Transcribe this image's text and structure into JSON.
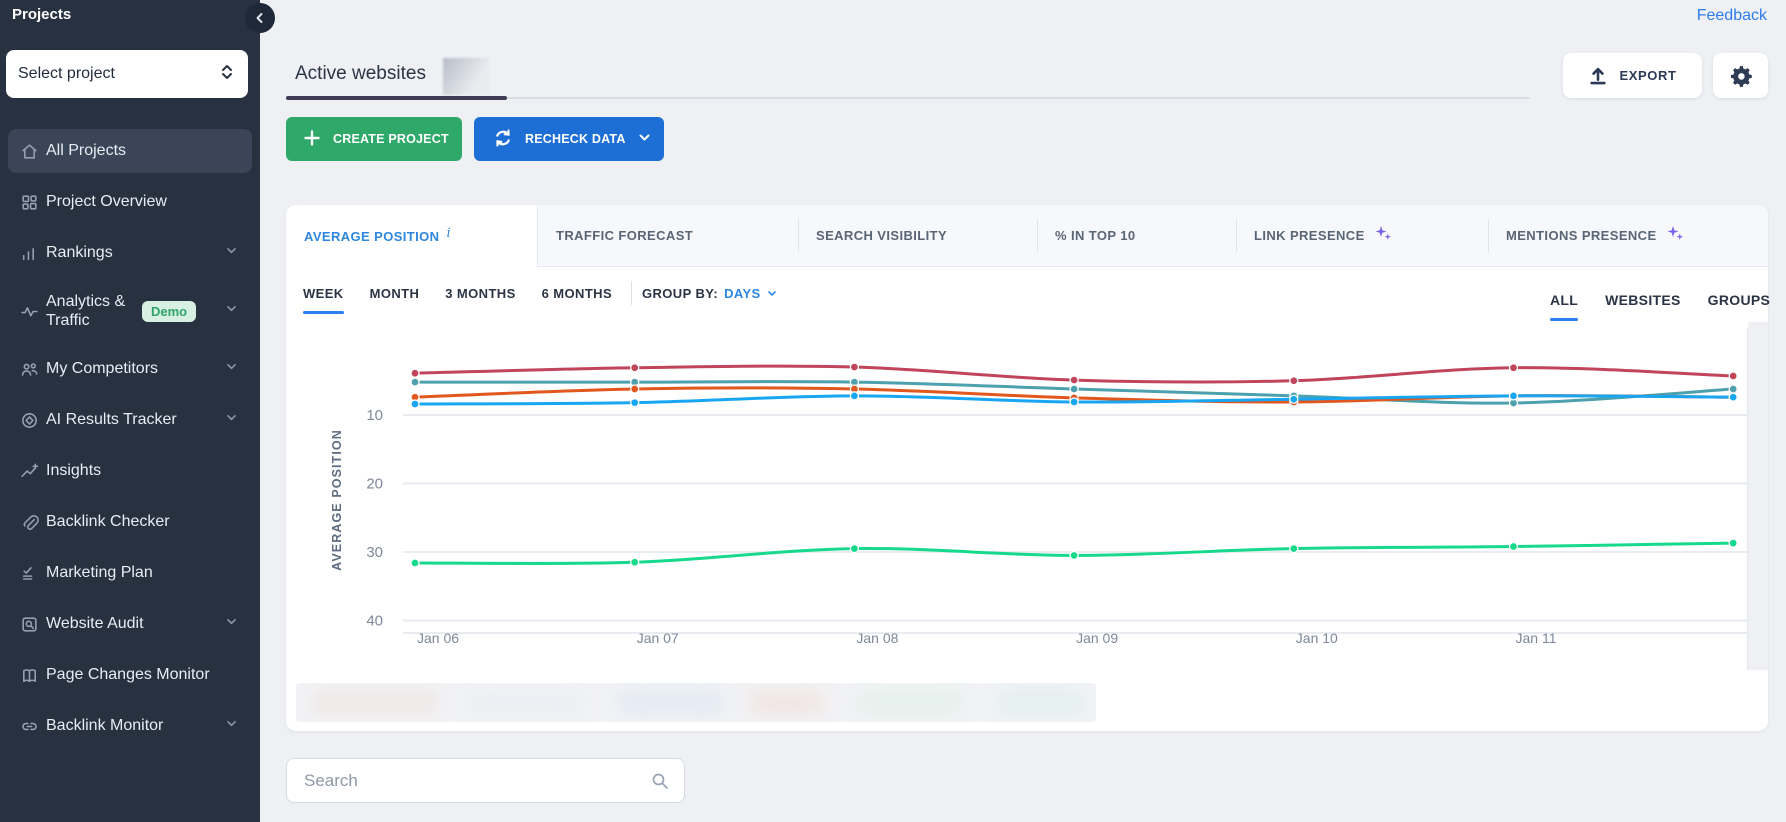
{
  "sidebar": {
    "title": "Projects",
    "select_placeholder": "Select project",
    "items": [
      {
        "label": "All Projects",
        "icon": "home",
        "active": true
      },
      {
        "label": "Project Overview",
        "icon": "grid"
      },
      {
        "label": "Rankings",
        "icon": "bar-chart",
        "expandable": true
      },
      {
        "label": "Analytics & Traffic",
        "icon": "activity",
        "expandable": true,
        "badge": "Demo",
        "two_line": true
      },
      {
        "label": "My Competitors",
        "icon": "people",
        "expandable": true
      },
      {
        "label": "AI Results Tracker",
        "icon": "ai-target",
        "expandable": true
      },
      {
        "label": "Insights",
        "icon": "insights"
      },
      {
        "label": "Backlink Checker",
        "icon": "paperclip"
      },
      {
        "label": "Marketing Plan",
        "icon": "checklist"
      },
      {
        "label": "Website Audit",
        "icon": "audit",
        "expandable": true
      },
      {
        "label": "Page Changes Monitor",
        "icon": "pages"
      },
      {
        "label": "Backlink Monitor",
        "icon": "link",
        "expandable": true
      }
    ]
  },
  "header": {
    "feedback": "Feedback",
    "tab": "Active websites",
    "create_project": "CREATE PROJECT",
    "recheck_data": "RECHECK DATA",
    "export": "EXPORT"
  },
  "metric_tabs": [
    {
      "label": "AVERAGE POSITION",
      "active": true,
      "info": true
    },
    {
      "label": "TRAFFIC FORECAST"
    },
    {
      "label": "SEARCH VISIBILITY"
    },
    {
      "label": "% IN TOP 10"
    },
    {
      "label": "LINK PRESENCE",
      "sparkle": true
    },
    {
      "label": "MENTIONS PRESENCE",
      "sparkle": true
    }
  ],
  "toolbar": {
    "ranges": [
      {
        "label": "WEEK",
        "active": true
      },
      {
        "label": "MONTH"
      },
      {
        "label": "3 MONTHS"
      },
      {
        "label": "6 MONTHS"
      }
    ],
    "group_by_label": "GROUP BY:",
    "group_by_value": "DAYS",
    "scopes": [
      {
        "label": "ALL",
        "active": true
      },
      {
        "label": "WEBSITES"
      },
      {
        "label": "GROUPS"
      }
    ]
  },
  "search": {
    "placeholder": "Search"
  },
  "chart_data": {
    "type": "line",
    "ylabel": "AVERAGE POSITION",
    "y_inverted": true,
    "yticks": [
      10,
      20,
      30,
      40
    ],
    "ylim": [
      0,
      45
    ],
    "grid": "horizontal",
    "x_labels": [
      "Jan 06",
      "Jan 07",
      "Jan 08",
      "Jan 09",
      "Jan 10",
      "Jan 11",
      ""
    ],
    "series": [
      {
        "name": "red",
        "color": "#c0455a",
        "values": [
          3.9,
          3.1,
          3.0,
          4.9,
          5.0,
          3.1,
          4.3
        ]
      },
      {
        "name": "teal",
        "color": "#4da1ad",
        "values": [
          5.2,
          5.2,
          5.2,
          6.2,
          7.2,
          8.25,
          6.2
        ]
      },
      {
        "name": "orange",
        "color": "#e2571d",
        "values": [
          7.4,
          6.2,
          6.2,
          7.5,
          8.1,
          7.2,
          7.4
        ]
      },
      {
        "name": "blue",
        "color": "#18a5f2",
        "values": [
          8.4,
          8.2,
          7.2,
          8.1,
          7.7,
          7.2,
          7.4
        ]
      },
      {
        "name": "green",
        "color": "#17d98b",
        "values": [
          31.6,
          31.5,
          29.5,
          30.5,
          29.5,
          29.2,
          28.7
        ]
      }
    ]
  }
}
